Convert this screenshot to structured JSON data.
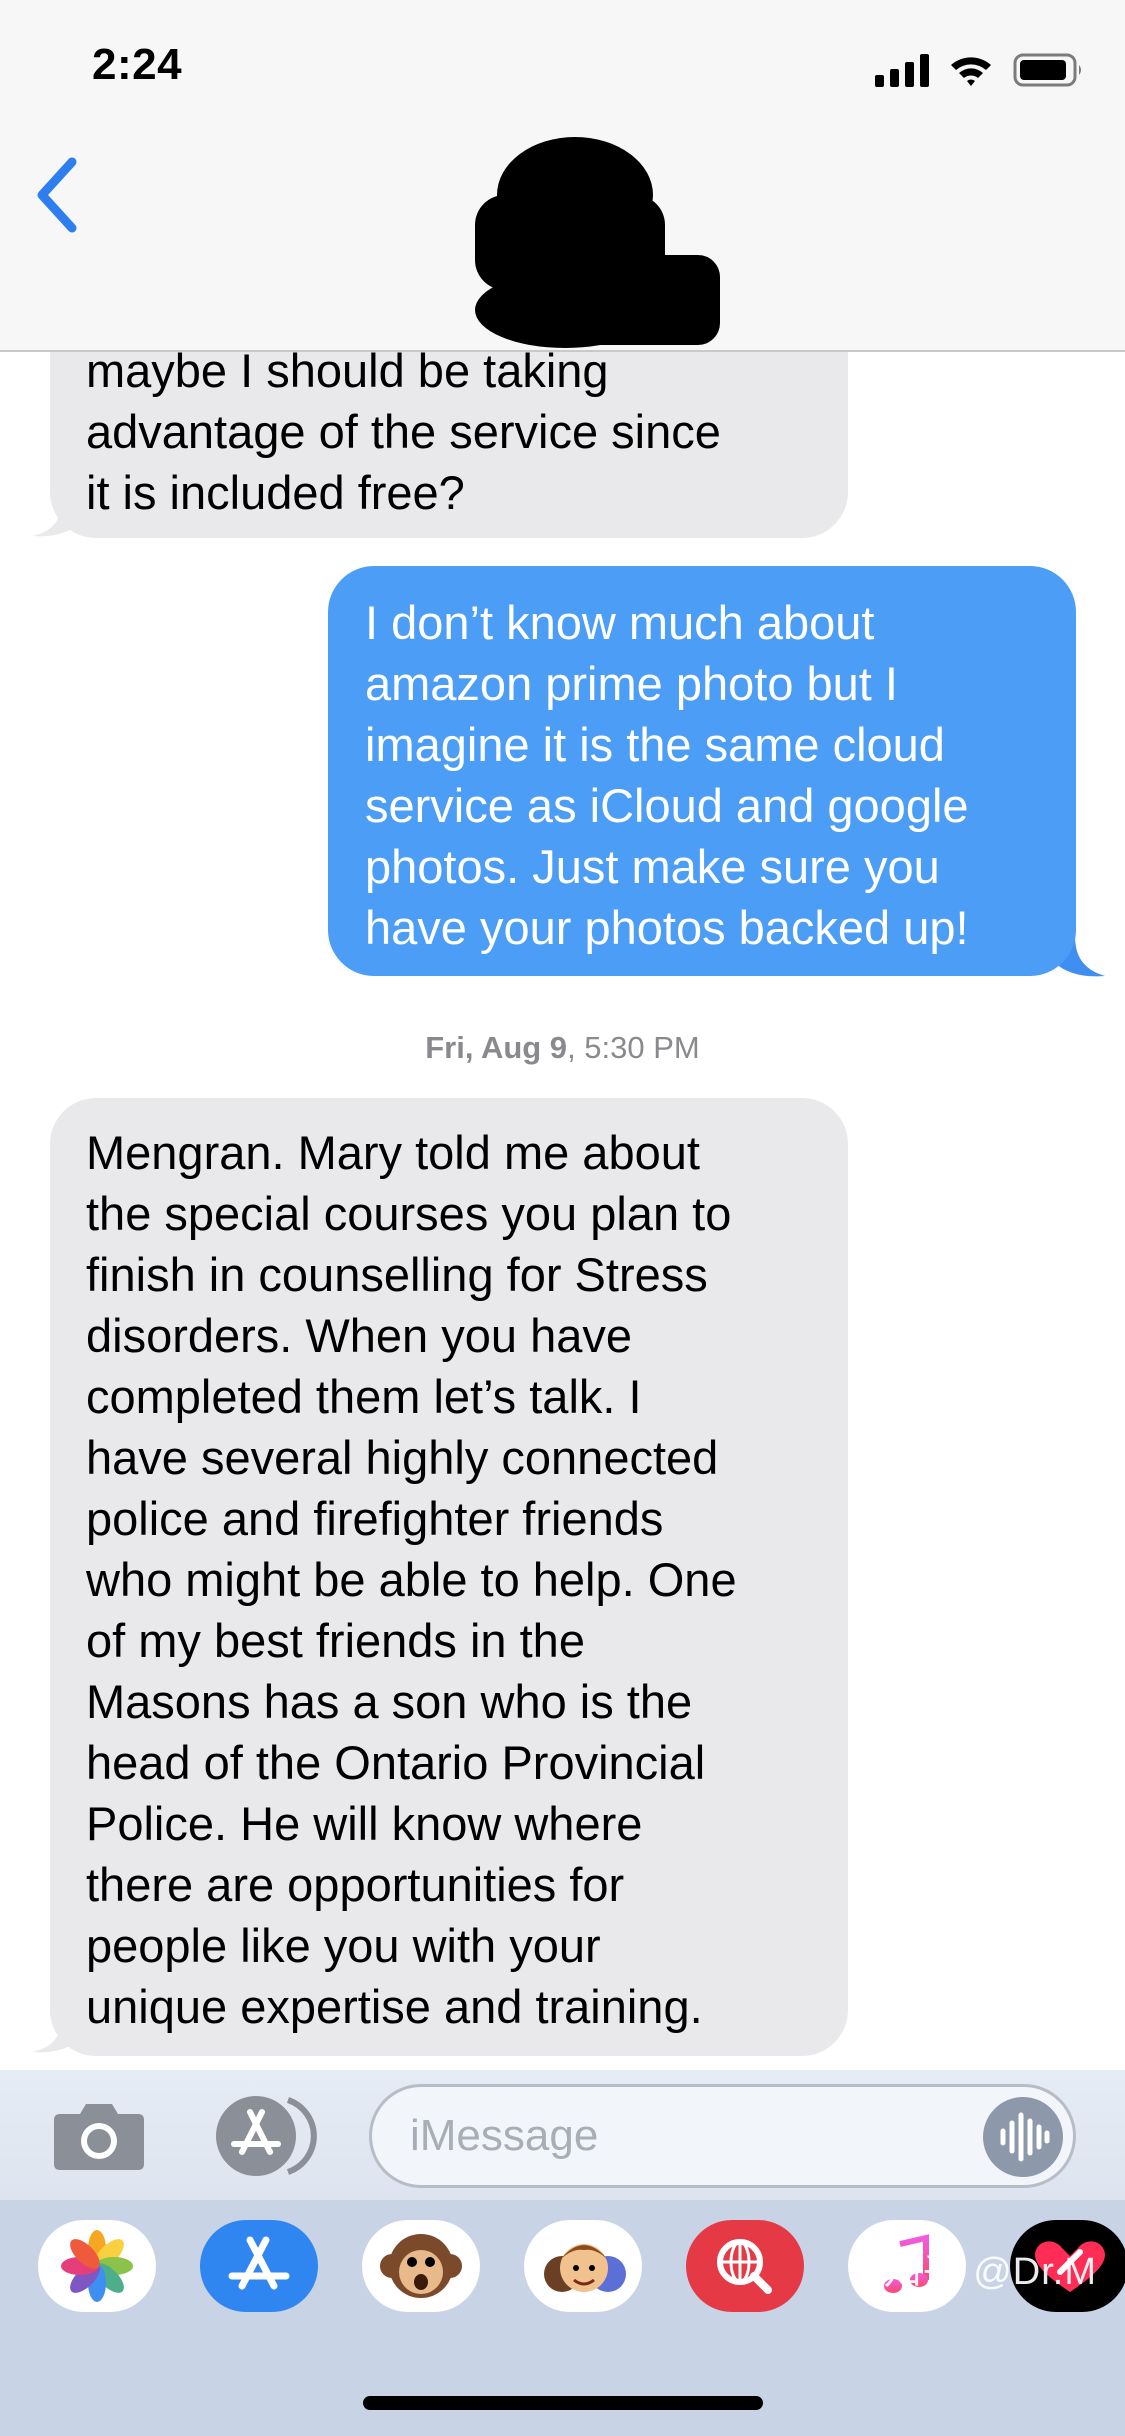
{
  "status_bar": {
    "time": "2:24"
  },
  "messages": [
    {
      "direction": "incoming",
      "lines": [
        "maybe I should be taking",
        "advantage of the service since",
        "it is included free?"
      ]
    },
    {
      "direction": "outgoing",
      "lines": [
        "I don’t know much about",
        "amazon prime photo but I",
        "imagine it is the same cloud",
        "service as iCloud and google",
        "photos. Just make sure you",
        "have your photos backed up!"
      ]
    },
    {
      "direction": "incoming",
      "lines": [
        "Mengran. Mary told me about",
        "the special courses you plan to",
        "finish in counselling for Stress",
        "disorders. When you have",
        "completed them let’s talk. I",
        "have several highly connected",
        "police and firefighter friends",
        "who might be able to help. One",
        "of my best friends in the",
        "Masons has a son who is the",
        "head of the Ontario Provincial",
        "Police. He will know where",
        "there are opportunities for",
        "people like you with your",
        "unique expertise and training."
      ]
    }
  ],
  "timestamp": {
    "day": "Fri, Aug 9",
    "time": "5:30 PM"
  },
  "composer": {
    "placeholder": "iMessage"
  },
  "app_drawer": [
    "photos-app",
    "app-store",
    "animoji",
    "memoji-stickers",
    "web-images-search",
    "music",
    "digital-touch"
  ],
  "watermark": "知乎 @Dr.M",
  "colors": {
    "incoming_bubble": "#e9e9eb",
    "outgoing_bubble": "#4c9df5",
    "accent": "#2f7ef0"
  }
}
